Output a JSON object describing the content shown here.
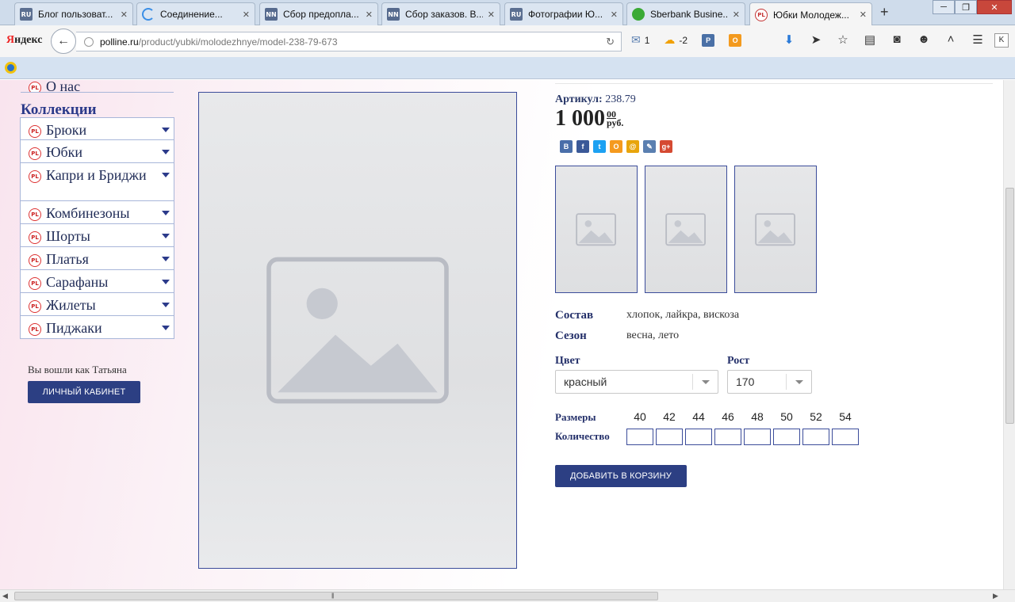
{
  "browser": {
    "tabs": [
      {
        "favicon": "ru",
        "title": "Блог пользоват..."
      },
      {
        "favicon": "loading",
        "title": "Соединение..."
      },
      {
        "favicon": "nn",
        "title": "Сбор предопла..."
      },
      {
        "favicon": "nn",
        "title": "Сбор заказов. В..."
      },
      {
        "favicon": "ru",
        "title": "Фотографии Ю..."
      },
      {
        "favicon": "sber",
        "title": "Sberbank Busine..."
      },
      {
        "favicon": "pl",
        "title": "Юбки Молодеж..."
      }
    ],
    "active_tab": 6,
    "new_tab_label": "+",
    "logo": {
      "first": "Я",
      "rest": "ндекс"
    },
    "url_host": "polline.ru",
    "url_path": "/product/yubki/molodezhnye/model-238-79-673",
    "mail_count": "1",
    "weather": "-2",
    "k_label": "K"
  },
  "sidebar": {
    "about": "О нас",
    "collections_heading": "Коллекции",
    "items": [
      {
        "label": "Брюки"
      },
      {
        "label": "Юбки"
      },
      {
        "label": "Капри и Бриджи"
      },
      {
        "label": "Комбинезоны"
      },
      {
        "label": "Шорты"
      },
      {
        "label": "Платья"
      },
      {
        "label": "Сарафаны"
      },
      {
        "label": "Жилеты"
      },
      {
        "label": "Пиджаки"
      }
    ],
    "logged_in_text": "Вы вошли как Татьяна",
    "cabinet_button": "Личный кабинет"
  },
  "product": {
    "article_label": "Артикул:",
    "article_value": "238.79",
    "price_main": "1 000",
    "price_cents": "00",
    "price_currency": "руб.",
    "social": [
      "В",
      "f",
      "t",
      "О",
      "@",
      "✎",
      "g+"
    ],
    "properties": [
      {
        "key": "Состав",
        "value": "хлопок, лайкра, вискоза"
      },
      {
        "key": "Сезон",
        "value": "весна, лето"
      }
    ],
    "color_label": "Цвет",
    "color_value": "красный",
    "height_label": "Рост",
    "height_value": "170",
    "sizes_label": "Размеры",
    "quantity_label": "Количество",
    "sizes": [
      "40",
      "42",
      "44",
      "46",
      "48",
      "50",
      "52",
      "54"
    ],
    "add_to_cart": "Добавить в корзину"
  },
  "colors": {
    "accent": "#2c3f83",
    "heading": "#2b3a8a",
    "border": "#3b4c9a"
  }
}
